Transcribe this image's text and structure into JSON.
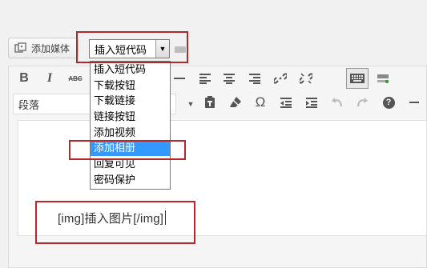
{
  "media_button": {
    "label": "添加媒体",
    "icon": "media-icon"
  },
  "shortcode": {
    "selected": "插入短代码",
    "options": [
      "插入短代码",
      "下载按钮",
      "下载链接",
      "链接按钮",
      "添加视频",
      "添加相册",
      "回复可见",
      "密码保护"
    ],
    "highlighted_option": "添加相册"
  },
  "toolbar": {
    "row1": [
      "bold-icon",
      "italic-icon",
      "strikethrough-icon",
      "hr-icon",
      "align-left-icon",
      "align-center-icon",
      "align-right-icon",
      "link-icon",
      "unlink-icon",
      "keyboard-toggle-icon",
      "insert-more-icon"
    ],
    "row1_labels": {
      "bold": "B",
      "italic": "I",
      "strike": "ABC"
    },
    "format_value": "段落",
    "row2": [
      "text-color-icon",
      "paste-text-icon",
      "clear-format-icon",
      "special-char-icon",
      "outdent-icon",
      "indent-icon",
      "undo-icon",
      "redo-icon",
      "help-icon",
      "collapse-icon"
    ],
    "row2_labels": {
      "omega": "Ω",
      "help": "?"
    }
  },
  "content": {
    "text": "[img]插入图片[/img]"
  },
  "colors": {
    "highlight_border": "#b5272d",
    "selection_bg": "#3399ff"
  }
}
